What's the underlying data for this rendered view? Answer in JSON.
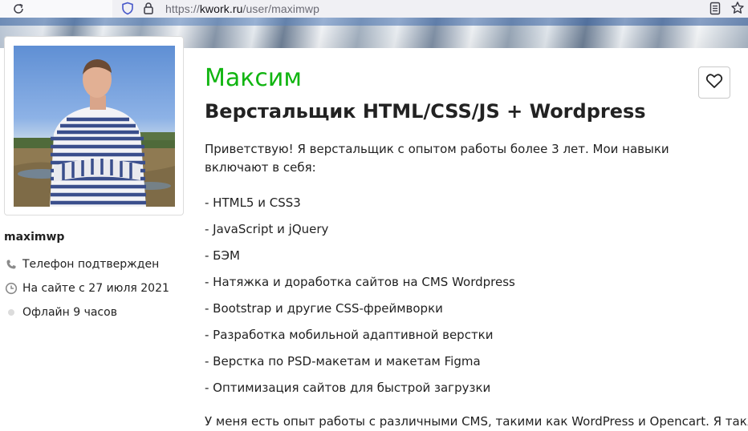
{
  "browser": {
    "url_prefix": "https://",
    "url_domain": "kwork.ru",
    "url_path": "/user/maximwp"
  },
  "profile": {
    "username": "maximwp",
    "phone_status": "Телефон подтвержден",
    "member_since": "На сайте с 27 июля 2021",
    "online_status": "Офлайн 9 часов"
  },
  "main": {
    "name": "Максим",
    "specialization": "Верстальщик HTML/CSS/JS + Wordpress",
    "intro": "Приветствую! Я верстальщик с опытом работы более 3 лет. Мои навыки включают в себя:",
    "skills": [
      "- HTML5 и CSS3",
      "- JavaScript и jQuery",
      "- БЭМ",
      "- Натяжка и доработка сайтов на CMS Wordpress",
      "- Bootstrap и другие CSS-фреймворки",
      "- Разработка мобильной адаптивной верстки",
      "- Верстка по PSD-макетам и макетам Figma",
      "- Оптимизация сайтов для быстрой загрузки"
    ],
    "outro": "У меня есть опыт работы с различными CMS, такими как WordPress и Opencart. Я также"
  },
  "icons": {
    "reload": "reload-icon",
    "shield": "shield-icon",
    "lock": "lock-icon",
    "reader": "reader-view-icon",
    "bookmark": "star-icon",
    "phone": "phone-icon",
    "clock": "clock-icon",
    "status": "status-dot-icon",
    "favorite": "heart-icon"
  },
  "colors": {
    "name_green": "#11b511",
    "status_dot": "#d9d9d9"
  }
}
